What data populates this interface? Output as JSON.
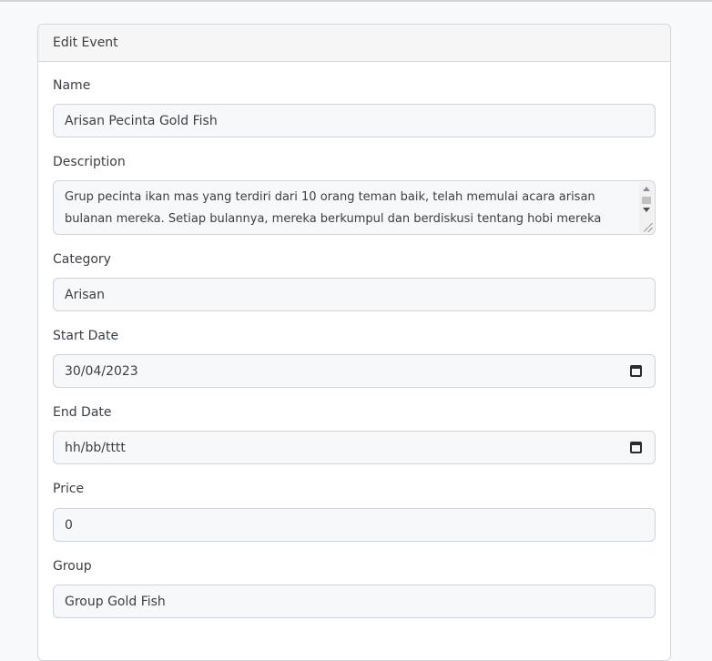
{
  "form": {
    "title": "Edit Event",
    "name": {
      "label": "Name",
      "value": "Arisan Pecinta Gold Fish"
    },
    "description": {
      "label": "Description",
      "value": "Grup pecinta ikan mas yang terdiri dari 10 orang teman baik, telah memulai acara arisan bulanan mereka. Setiap bulannya, mereka berkumpul dan berdiskusi tentang hobi mereka yang"
    },
    "category": {
      "label": "Category",
      "value": "Arisan"
    },
    "start_date": {
      "label": "Start Date",
      "value": "30/04/2023"
    },
    "end_date": {
      "label": "End Date",
      "value": "hh/bb/tttt"
    },
    "price": {
      "label": "Price",
      "value": "0"
    },
    "group": {
      "label": "Group",
      "value": "Group Gold Fish"
    }
  },
  "icons": {
    "calendar": "calendar-icon",
    "resize": "resize-handle-icon"
  },
  "colors": {
    "page_bg": "#f8f9fb",
    "card_border": "#d3d6da",
    "field_bg": "#f7f8fa"
  }
}
